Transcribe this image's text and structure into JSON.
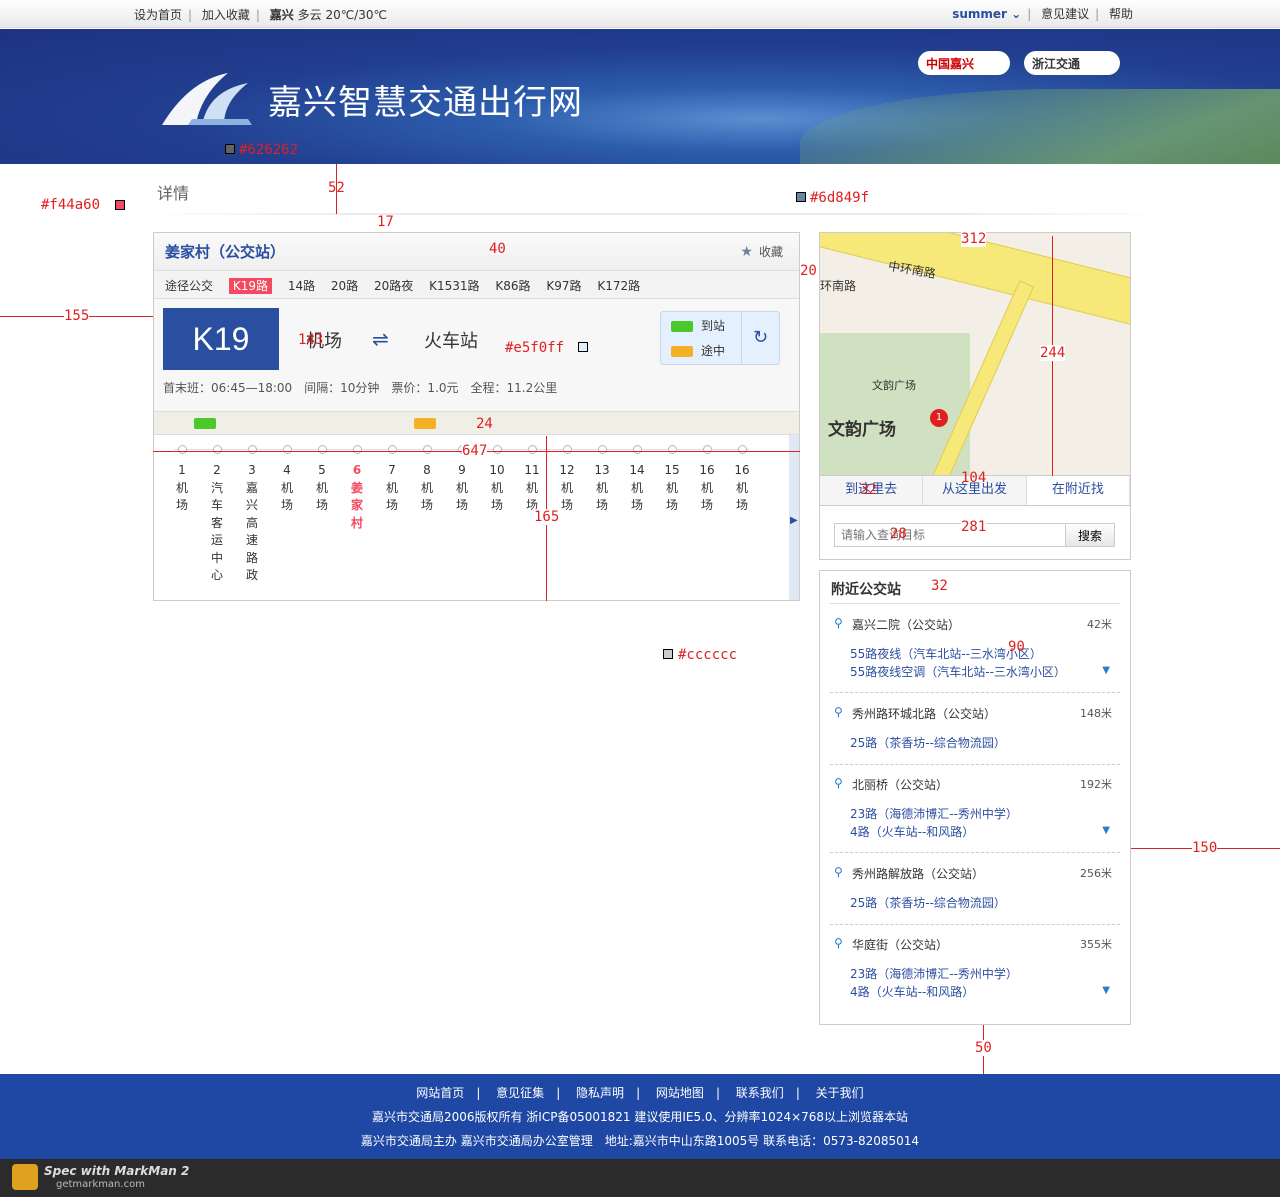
{
  "topbar": {
    "set_home": "设为首页",
    "add_fav": "加入收藏",
    "city": "嘉兴",
    "weather": "多云 20℃/30℃",
    "user": "summer",
    "feedback": "意见建议",
    "help": "帮助"
  },
  "banner": {
    "title": "嘉兴智慧交通出行网",
    "partner1": "中国嘉兴",
    "partner2": "浙江交通"
  },
  "page": {
    "section_title": "详情"
  },
  "station": {
    "name": "姜家村（公交站）",
    "favorite": "收藏",
    "routes_label": "途径公交",
    "routes": [
      "K19路",
      "14路",
      "20路",
      "20路夜",
      "K1531路",
      "K86路",
      "K97路",
      "K172路"
    ],
    "current_route": "K19",
    "from": "机场",
    "to": "火车站",
    "legend_arrived": "到站",
    "legend_enroute": "途中",
    "info": "首末班：06:45—18:00　间隔：10分钟　票价：1.0元　全程：11.2公里"
  },
  "stops": [
    {
      "n": "1",
      "name": "机场"
    },
    {
      "n": "2",
      "name": "汽车客运中心"
    },
    {
      "n": "3",
      "name": "嘉兴高速路政"
    },
    {
      "n": "4",
      "name": "机场"
    },
    {
      "n": "5",
      "name": "机场"
    },
    {
      "n": "6",
      "name": "姜家村",
      "current": true
    },
    {
      "n": "7",
      "name": "机场"
    },
    {
      "n": "8",
      "name": "机场"
    },
    {
      "n": "9",
      "name": "机场"
    },
    {
      "n": "10",
      "name": "机场"
    },
    {
      "n": "11",
      "name": "机场"
    },
    {
      "n": "12",
      "name": "机场"
    },
    {
      "n": "13",
      "name": "机场"
    },
    {
      "n": "14",
      "name": "机场"
    },
    {
      "n": "15",
      "name": "机场"
    },
    {
      "n": "16",
      "name": "机场"
    },
    {
      "n": "16",
      "name": "机场"
    }
  ],
  "map": {
    "road1": "中环南路",
    "road2": "环南路",
    "poi": "文韵广场",
    "poi_big": "文韵广场",
    "pin": "1",
    "tabs": [
      "到这里去",
      "从这里出发",
      "在附近找"
    ],
    "search_placeholder": "请输入查询目标",
    "search_button": "搜索"
  },
  "nearby": {
    "title": "附近公交站",
    "stops": [
      {
        "name": "嘉兴二院（公交站）",
        "dist": "42米",
        "lines": [
          "55路夜线（汽车北站--三水湾小区）",
          "55路夜线空调（汽车北站--三水湾小区）"
        ]
      },
      {
        "name": "秀州路环城北路（公交站）",
        "dist": "148米",
        "lines": [
          "25路（茶香坊--综合物流园）"
        ]
      },
      {
        "name": "北丽桥（公交站）",
        "dist": "192米",
        "lines": [
          "23路（海德沛博汇--秀州中学）",
          "4路（火车站--和风路）"
        ]
      },
      {
        "name": "秀州路解放路（公交站）",
        "dist": "256米",
        "lines": [
          "25路（茶香坊--综合物流园）"
        ]
      },
      {
        "name": "华庭街（公交站）",
        "dist": "355米",
        "lines": [
          "23路（海德沛博汇--秀州中学）",
          "4路（火车站--和风路）"
        ]
      }
    ]
  },
  "footer": {
    "links": [
      "网站首页",
      "意见征集",
      "隐私声明",
      "网站地图",
      "联系我们",
      "关于我们"
    ],
    "line2": "嘉兴市交通局2006版权所有 浙ICP备05001821 建议使用IE5.0、分辨率1024×768以上浏览器本站",
    "line3": "嘉兴市交通局主办 嘉兴市交通局办公室管理　地址:嘉兴市中山东路1005号 联系电话：0573-82085014"
  },
  "markman": {
    "title": "Spec with MarkMan 2",
    "url": "getmarkman.com"
  },
  "annotations": {
    "c1": "#626262",
    "c2": "#f44a60",
    "c3": "#6d849f",
    "c4": "#e5f0ff",
    "c5": "#cccccc",
    "d52": "52",
    "d17": "17",
    "d40": "40",
    "d20": "20",
    "d155": "155",
    "d143": "143",
    "d24": "24",
    "d647": "647",
    "d165": "165",
    "d312": "312",
    "d244": "244",
    "d104": "104",
    "d32a": "32",
    "d281": "281",
    "d28": "28",
    "d32b": "32",
    "d90": "90",
    "d150": "150",
    "d50": "50"
  }
}
